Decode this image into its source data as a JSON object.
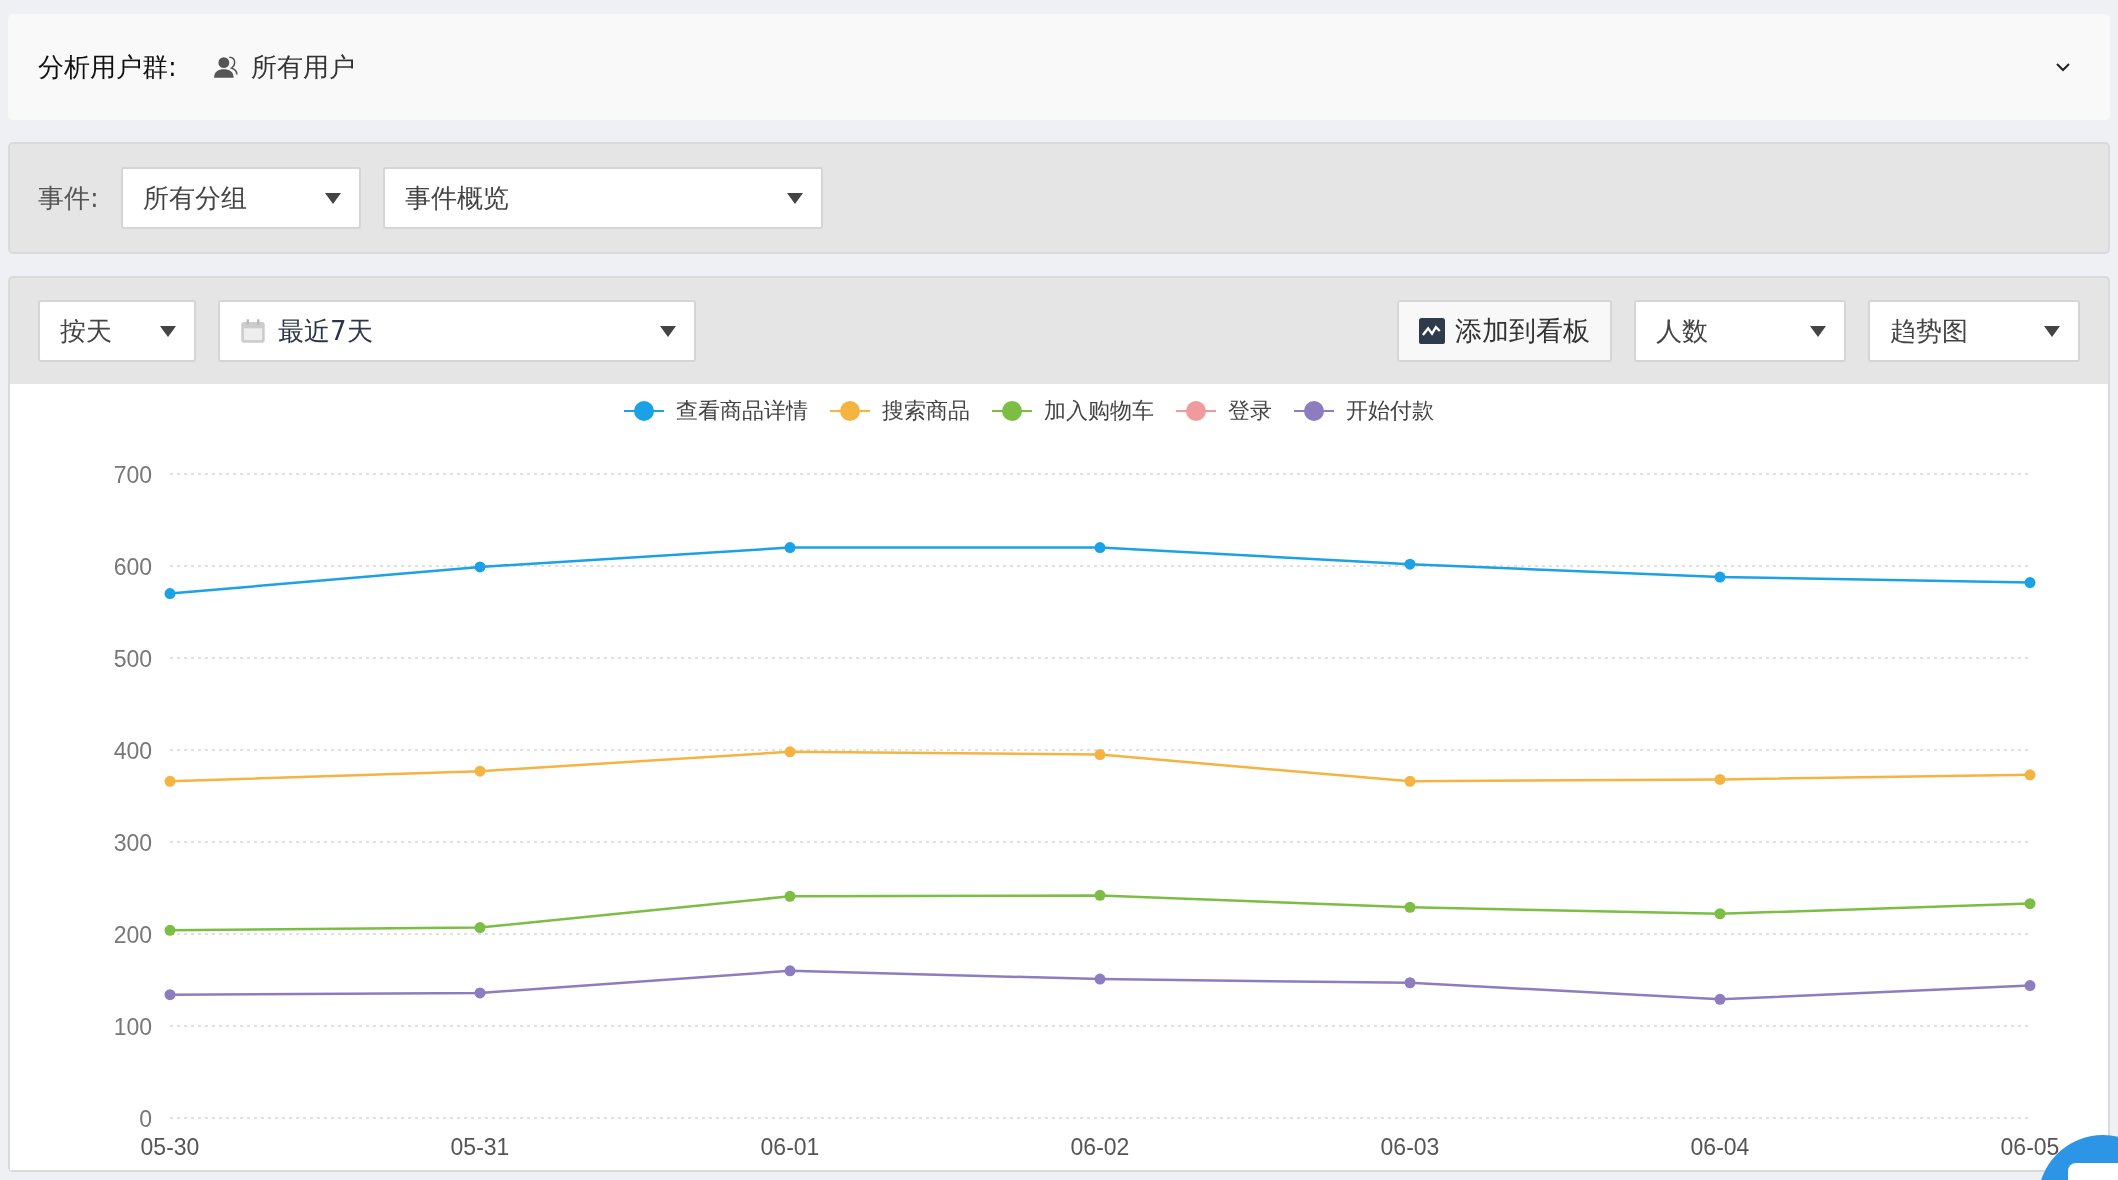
{
  "user_group": {
    "label": "分析用户群:",
    "value": "所有用户"
  },
  "event_filter": {
    "label": "事件:",
    "group_select": "所有分组",
    "event_select": "事件概览"
  },
  "toolbar": {
    "granularity": "按天",
    "date_range": "最近7天",
    "add_button": "添加到看板",
    "metric": "人数",
    "chart_type": "趋势图"
  },
  "chart": {
    "chart_data": {
      "type": "line",
      "grid": true,
      "legend": "top",
      "categories": [
        "05-30",
        "05-31",
        "06-01",
        "06-02",
        "06-03",
        "06-04",
        "06-05"
      ],
      "ylim": [
        0,
        700
      ],
      "yticks": [
        0,
        100,
        200,
        300,
        400,
        500,
        600,
        700
      ],
      "series": [
        {
          "name": "查看商品详情",
          "color": "#1aa1e6",
          "marker": "circle",
          "values": [
            570,
            599,
            620,
            620,
            602,
            588,
            582
          ]
        },
        {
          "name": "搜索商品",
          "color": "#f5b342",
          "marker": "circle",
          "values": [
            366,
            377,
            398,
            395,
            366,
            368,
            373
          ]
        },
        {
          "name": "加入购物车",
          "color": "#7cbd44",
          "marker": "circle",
          "values": [
            204,
            207,
            241,
            242,
            229,
            222,
            233
          ]
        },
        {
          "name": "登录",
          "color": "#f09a9c",
          "values": [
            null,
            null,
            null,
            null,
            null,
            null,
            null
          ]
        },
        {
          "name": "开始付款",
          "color": "#8d7cc0",
          "marker": "circle",
          "values": [
            134,
            136,
            160,
            151,
            147,
            129,
            144
          ]
        }
      ]
    }
  }
}
